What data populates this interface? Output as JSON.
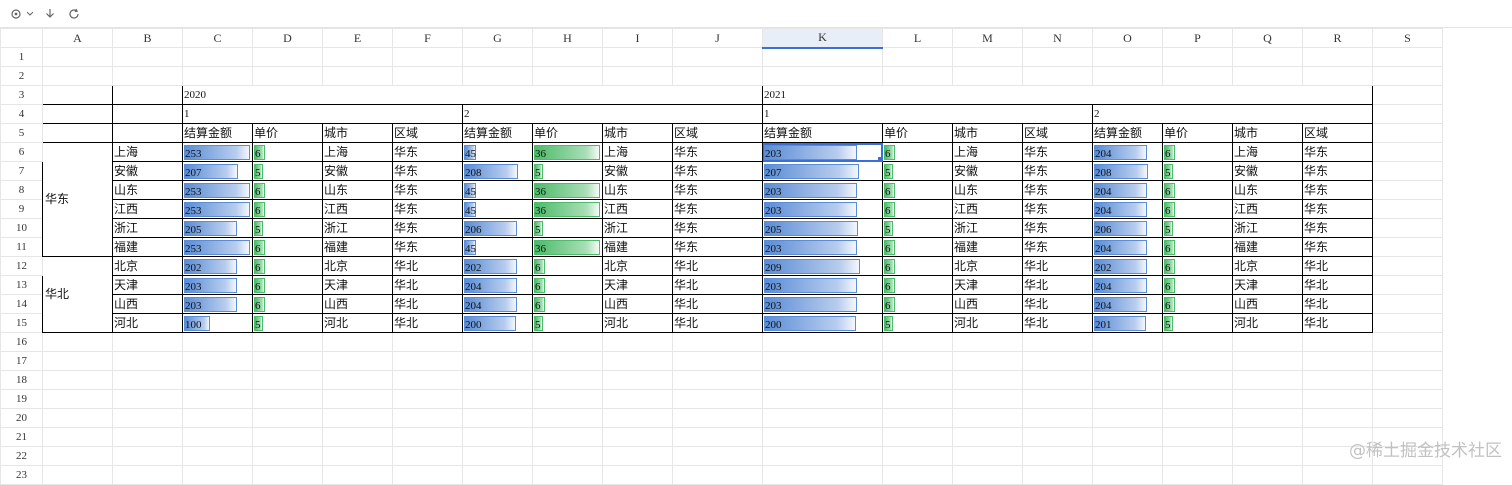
{
  "toolbar": {
    "icons": [
      "settings-icon",
      "chevron-down-icon",
      "download-icon",
      "refresh-icon"
    ]
  },
  "columns": [
    "A",
    "B",
    "C",
    "D",
    "E",
    "F",
    "G",
    "H",
    "I",
    "J",
    "K",
    "L",
    "M",
    "N",
    "O",
    "P",
    "Q",
    "R",
    "S"
  ],
  "selected_column": "K",
  "row_count": 23,
  "years": [
    "2020",
    "2021"
  ],
  "subgroups": [
    "1",
    "2"
  ],
  "headers": [
    "结算金额",
    "单价",
    "城市",
    "区域"
  ],
  "regions": [
    {
      "name": "华东",
      "rows": 6
    },
    {
      "name": "华北",
      "rows": 4
    }
  ],
  "rows": [
    {
      "city": "上海",
      "region": "华东",
      "vals": [
        [
          253,
          6
        ],
        [
          45,
          36
        ],
        [
          203,
          6
        ],
        [
          204,
          6
        ]
      ]
    },
    {
      "city": "安徽",
      "region": "华东",
      "vals": [
        [
          207,
          5
        ],
        [
          208,
          5
        ],
        [
          207,
          5
        ],
        [
          208,
          5
        ]
      ]
    },
    {
      "city": "山东",
      "region": "华东",
      "vals": [
        [
          253,
          6
        ],
        [
          45,
          36
        ],
        [
          203,
          6
        ],
        [
          204,
          6
        ]
      ]
    },
    {
      "city": "江西",
      "region": "华东",
      "vals": [
        [
          253,
          6
        ],
        [
          45,
          36
        ],
        [
          203,
          6
        ],
        [
          204,
          6
        ]
      ]
    },
    {
      "city": "浙江",
      "region": "华东",
      "vals": [
        [
          205,
          5
        ],
        [
          206,
          5
        ],
        [
          205,
          5
        ],
        [
          206,
          5
        ]
      ]
    },
    {
      "city": "福建",
      "region": "华东",
      "vals": [
        [
          253,
          6
        ],
        [
          45,
          36
        ],
        [
          203,
          6
        ],
        [
          204,
          6
        ]
      ]
    },
    {
      "city": "北京",
      "region": "华北",
      "vals": [
        [
          202,
          6
        ],
        [
          202,
          6
        ],
        [
          209,
          6
        ],
        [
          202,
          6
        ]
      ]
    },
    {
      "city": "天津",
      "region": "华北",
      "vals": [
        [
          203,
          6
        ],
        [
          204,
          6
        ],
        [
          203,
          6
        ],
        [
          204,
          6
        ]
      ]
    },
    {
      "city": "山西",
      "region": "华北",
      "vals": [
        [
          203,
          6
        ],
        [
          204,
          6
        ],
        [
          203,
          6
        ],
        [
          204,
          6
        ]
      ]
    },
    {
      "city": "河北",
      "region": "华北",
      "vals": [
        [
          100,
          5
        ],
        [
          200,
          5
        ],
        [
          200,
          5
        ],
        [
          201,
          5
        ]
      ]
    }
  ],
  "databar_max": {
    "amount": 253,
    "price": 36
  },
  "colors": {
    "amount_bar": "#5b8dd6",
    "price_bar": "#4cbb6a",
    "selection": "#3b6fd6"
  },
  "watermark": "@稀土掘金技术社区"
}
